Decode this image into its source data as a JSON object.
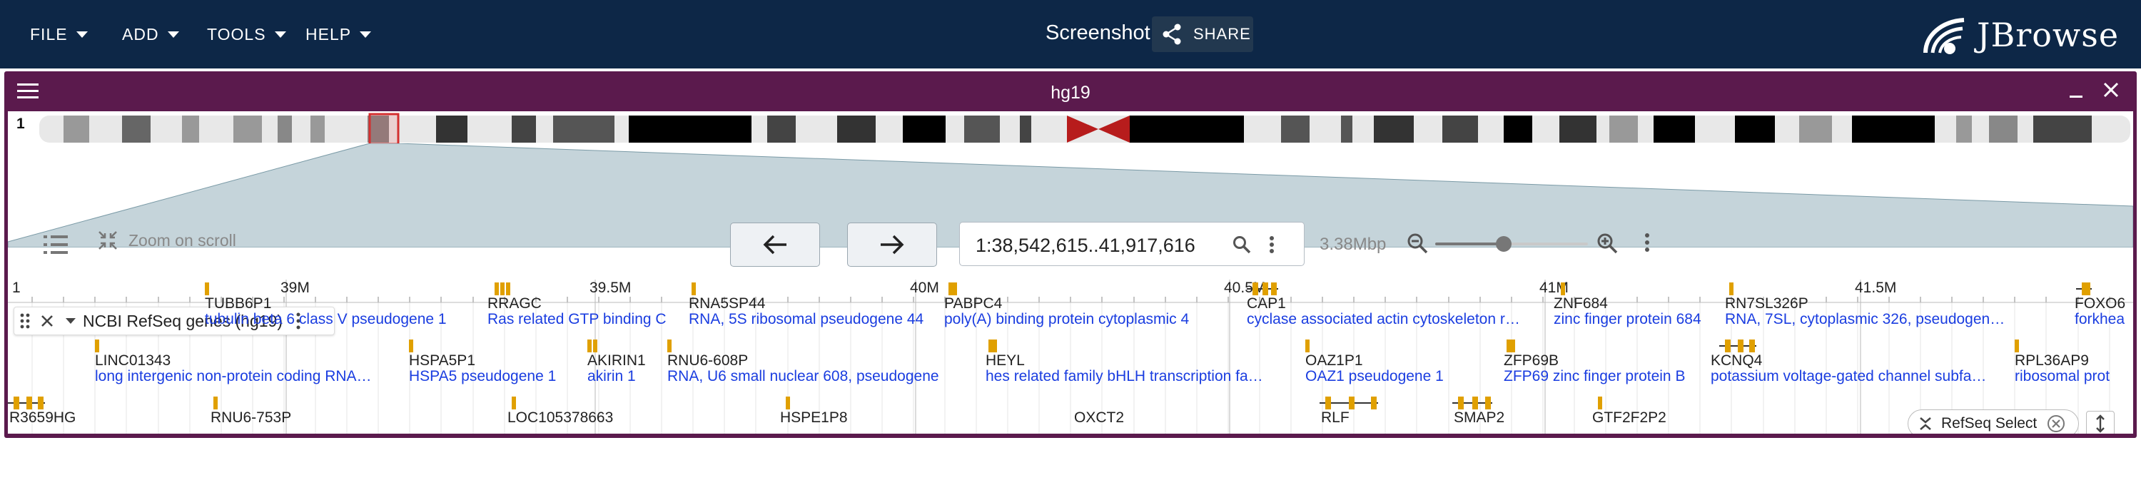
{
  "menu": [
    {
      "label": "FILE"
    },
    {
      "label": "ADD"
    },
    {
      "label": "TOOLS"
    },
    {
      "label": "HELP"
    }
  ],
  "session": {
    "name": "Screenshot",
    "share_label": "SHARE"
  },
  "brand": {
    "name": "JBrowse"
  },
  "view": {
    "title": "hg19",
    "chromosome": "1",
    "location": "1:38,542,615..41,917,616",
    "bp_per_px": "3.38Mbp",
    "zoom_on_scroll_label": "Zoom on scroll",
    "zoom_level": 0.45
  },
  "ruler": {
    "start_label": "1",
    "ticks": [
      "39M",
      "39.5M",
      "40M",
      "40.5M",
      "41M",
      "41.5M"
    ]
  },
  "track": {
    "name": "NCBI RefSeq genes (hg19)",
    "genes": [
      {
        "name": "TUBB6P1",
        "desc": "tubulin beta 6 class V pseudogene 1"
      },
      {
        "name": "RRAGC",
        "desc": "Ras related GTP binding C"
      },
      {
        "name": "RNA5SP44",
        "desc": "RNA, 5S ribosomal pseudogene 44"
      },
      {
        "name": "PABPC4",
        "desc": "poly(A) binding protein cytoplasmic 4"
      },
      {
        "name": "CAP1",
        "desc": "cyclase associated actin cytoskeleton r…"
      },
      {
        "name": "ZNF684",
        "desc": "zinc finger protein 684"
      },
      {
        "name": "RN7SL326P",
        "desc": "RNA, 7SL, cytoplasmic 326, pseudogen…"
      },
      {
        "name": "FOXO6",
        "desc": "forkhea"
      },
      {
        "name": "LINC01343",
        "desc": "long intergenic non-protein coding RNA…"
      },
      {
        "name": "HSPA5P1",
        "desc": "HSPA5 pseudogene 1"
      },
      {
        "name": "AKIRIN1",
        "desc": "akirin 1"
      },
      {
        "name": "RNU6-608P",
        "desc": "RNA, U6 small nuclear 608, pseudogene"
      },
      {
        "name": "HEYL",
        "desc": "hes related family bHLH transcription fa…"
      },
      {
        "name": "OAZ1P1",
        "desc": "OAZ1 pseudogene 1"
      },
      {
        "name": "ZFP69B",
        "desc": "ZFP69 zinc finger protein B"
      },
      {
        "name": "KCNQ4",
        "desc": "potassium voltage-gated channel subfa…"
      },
      {
        "name": "RPL36AP9",
        "desc": "ribosomal prot"
      },
      {
        "name": "R3659HG",
        "desc": ""
      },
      {
        "name": "RNU6-753P",
        "desc": ""
      },
      {
        "name": "LOC105378663",
        "desc": ""
      },
      {
        "name": "HSPE1P8",
        "desc": ""
      },
      {
        "name": "OXCT2",
        "desc": ""
      },
      {
        "name": "RLF",
        "desc": ""
      },
      {
        "name": "SMAP2",
        "desc": ""
      },
      {
        "name": "GTF2F2P2",
        "desc": ""
      }
    ],
    "filter_chip": "RefSeq Select"
  },
  "colors": {
    "appbar": "#0d2747",
    "view_header": "#5b1a4d",
    "gene_feature": "#e0a000",
    "gene_desc": "#1a3de0",
    "centromere": "#b71c1c"
  }
}
